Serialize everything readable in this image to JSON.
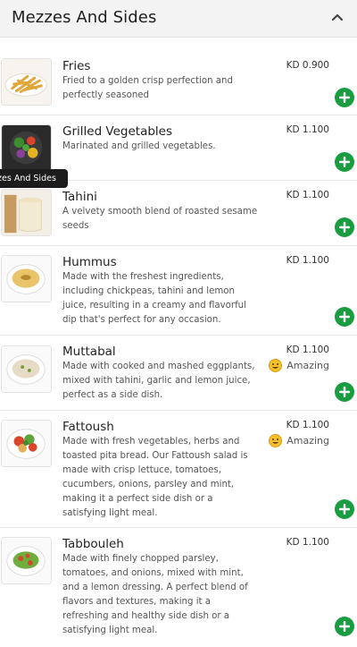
{
  "section": {
    "title": "Mezzes And Sides",
    "collapse_icon": "chevron-up-icon"
  },
  "tooltip": {
    "text": "Mezzes And Sides"
  },
  "accent_color": "#1a9c41",
  "items": [
    {
      "name": "Fries",
      "description": "Fried to a golden crisp perfection and perfectly seasoned",
      "price": "KD 0.900",
      "badge": null
    },
    {
      "name": "Grilled Vegetables",
      "description": "Marinated and grilled vegetables.",
      "price": "KD 1.100",
      "badge": null
    },
    {
      "name": "Tahini",
      "description": "A velvety smooth blend of roasted sesame seeds",
      "price": "KD 1.100",
      "badge": null
    },
    {
      "name": "Hummus",
      "description": "Made with the freshest ingredients, including chickpeas, tahini and lemon juice, resulting in a creamy and flavorful dip that's perfect for any occasion.",
      "price": "KD 1.100",
      "badge": null
    },
    {
      "name": "Muttabal",
      "description": "Made with cooked and mashed eggplants, mixed with tahini, garlic and lemon juice, perfect as a side dish.",
      "price": "KD 1.100",
      "badge": "Amazing"
    },
    {
      "name": "Fattoush",
      "description": "Made with fresh vegetables, herbs and toasted pita bread. Our Fattoush salad is made with crisp lettuce, tomatoes, cucumbers, onions, parsley and mint, making it a perfect side dish or a satisfying light meal.",
      "price": "KD 1.100",
      "badge": "Amazing"
    },
    {
      "name": "Tabbouleh",
      "description": "Made with finely chopped parsley, tomatoes, and onions, mixed with mint, and a lemon dressing. A perfect blend of flavors and textures, making it a refreshing and healthy side dish or a satisfying light meal.",
      "price": "KD 1.100",
      "badge": null
    }
  ]
}
